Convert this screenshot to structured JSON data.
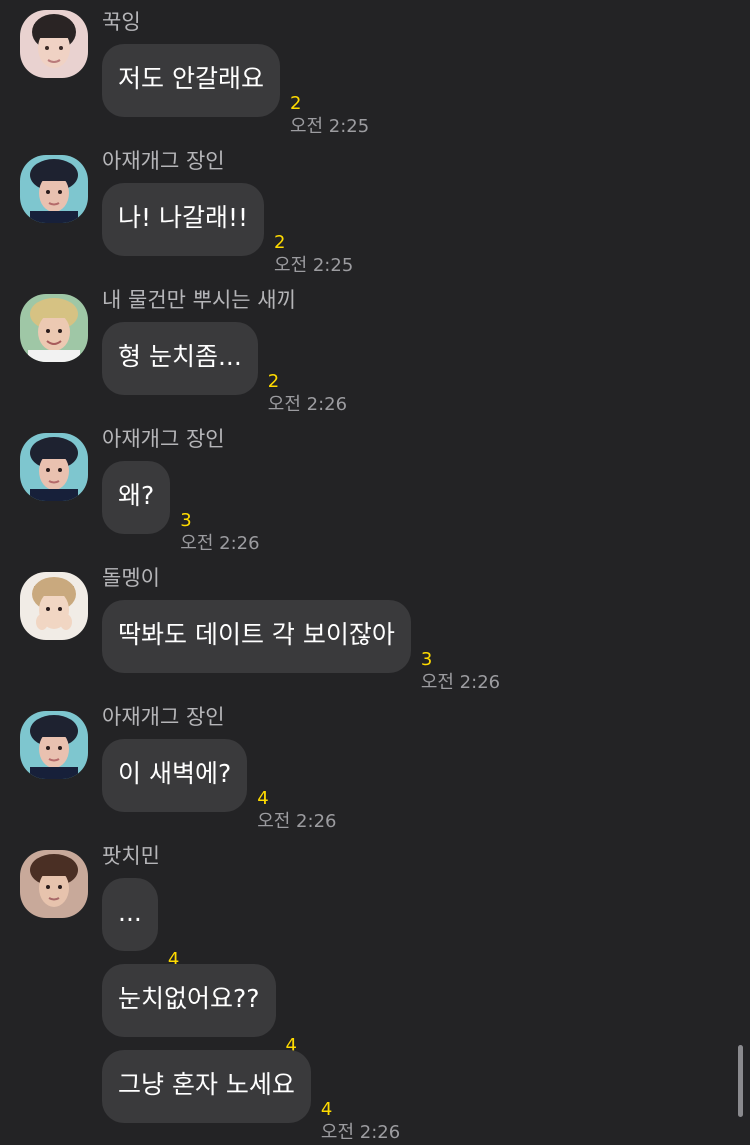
{
  "colors": {
    "background": "#232325",
    "bubble": "#3a3a3c",
    "bubble_text": "#ffffff",
    "sender_name": "#b5b5b8",
    "unread_count": "#ffdb00",
    "timestamp": "#9c9ca0"
  },
  "messages": [
    {
      "sender": "꾹잉",
      "avatar": "profile-photo-icon",
      "bubbles": [
        {
          "text": "저도 안갈래요",
          "unread": "2",
          "time": "오전 2:25"
        }
      ]
    },
    {
      "sender": "아재개그 장인",
      "avatar": "profile-photo-icon",
      "bubbles": [
        {
          "text": "나! 나갈래!!",
          "unread": "2",
          "time": "오전 2:25"
        }
      ]
    },
    {
      "sender": "내 물건만 뿌시는 새끼",
      "avatar": "profile-photo-icon",
      "bubbles": [
        {
          "text": "형 눈치좀...",
          "unread": "2",
          "time": "오전 2:26"
        }
      ]
    },
    {
      "sender": "아재개그 장인",
      "avatar": "profile-photo-icon",
      "bubbles": [
        {
          "text": "왜?",
          "unread": "3",
          "time": "오전 2:26"
        }
      ]
    },
    {
      "sender": "돌멩이",
      "avatar": "profile-photo-icon",
      "bubbles": [
        {
          "text": "딱봐도 데이트 각 보이잖아",
          "unread": "3",
          "time": "오전 2:26"
        }
      ]
    },
    {
      "sender": "아재개그 장인",
      "avatar": "profile-photo-icon",
      "bubbles": [
        {
          "text": "이 새벽에?",
          "unread": "4",
          "time": "오전 2:26"
        }
      ]
    },
    {
      "sender": "팟치민",
      "avatar": "profile-photo-icon",
      "bubbles": [
        {
          "text": "...",
          "unread": "4",
          "time": ""
        },
        {
          "text": "눈치없어요??",
          "unread": "4",
          "time": ""
        },
        {
          "text": "그냥 혼자 노세요",
          "unread": "4",
          "time": "오전 2:26"
        }
      ]
    }
  ]
}
